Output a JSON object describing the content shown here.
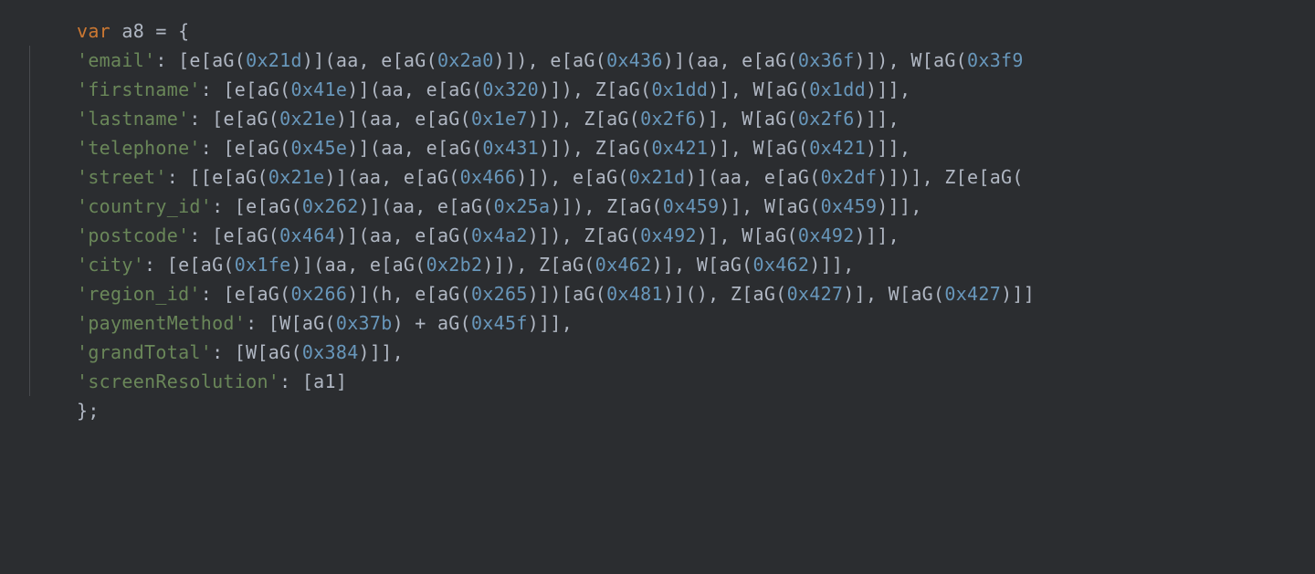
{
  "code": {
    "line1": {
      "var": "var",
      "name": "a8",
      "eq": " = {"
    },
    "entries": [
      {
        "key": "'email'",
        "sep": ": [e[aG(",
        "n1": "0x21d",
        "t1": ")](aa, e[aG(",
        "n2": "0x2a0",
        "t2": ")]), e[aG(",
        "n3": "0x436",
        "t3": ")](aa, e[aG(",
        "n4": "0x36f",
        "t4": ")]), W[aG(",
        "n5": "0x3f9",
        "tail": ""
      },
      {
        "key": "'firstname'",
        "sep": ": [e[aG(",
        "n1": "0x41e",
        "t1": ")](aa, e[aG(",
        "n2": "0x320",
        "t2": ")]), Z[aG(",
        "n3": "0x1dd",
        "t3": ")], W[aG(",
        "n4": "0x1dd",
        "t4": ")]],",
        "n5": "",
        "tail": ""
      },
      {
        "key": "'lastname'",
        "sep": ": [e[aG(",
        "n1": "0x21e",
        "t1": ")](aa, e[aG(",
        "n2": "0x1e7",
        "t2": ")]), Z[aG(",
        "n3": "0x2f6",
        "t3": ")], W[aG(",
        "n4": "0x2f6",
        "t4": ")]],",
        "n5": "",
        "tail": ""
      },
      {
        "key": "'telephone'",
        "sep": ": [e[aG(",
        "n1": "0x45e",
        "t1": ")](aa, e[aG(",
        "n2": "0x431",
        "t2": ")]), Z[aG(",
        "n3": "0x421",
        "t3": ")], W[aG(",
        "n4": "0x421",
        "t4": ")]],",
        "n5": "",
        "tail": ""
      },
      {
        "key": "'street'",
        "sep": ": [[e[aG(",
        "n1": "0x21e",
        "t1": ")](aa, e[aG(",
        "n2": "0x466",
        "t2": ")]), e[aG(",
        "n3": "0x21d",
        "t3": ")](aa, e[aG(",
        "n4": "0x2df",
        "t4": ")])], Z[e[aG(",
        "n5": "",
        "tail": ""
      },
      {
        "key": "'country_id'",
        "sep": ": [e[aG(",
        "n1": "0x262",
        "t1": ")](aa, e[aG(",
        "n2": "0x25a",
        "t2": ")]), Z[aG(",
        "n3": "0x459",
        "t3": ")], W[aG(",
        "n4": "0x459",
        "t4": ")]],",
        "n5": "",
        "tail": ""
      },
      {
        "key": "'postcode'",
        "sep": ": [e[aG(",
        "n1": "0x464",
        "t1": ")](aa, e[aG(",
        "n2": "0x4a2",
        "t2": ")]), Z[aG(",
        "n3": "0x492",
        "t3": ")], W[aG(",
        "n4": "0x492",
        "t4": ")]],",
        "n5": "",
        "tail": ""
      },
      {
        "key": "'city'",
        "sep": ": [e[aG(",
        "n1": "0x1fe",
        "t1": ")](aa, e[aG(",
        "n2": "0x2b2",
        "t2": ")]), Z[aG(",
        "n3": "0x462",
        "t3": ")], W[aG(",
        "n4": "0x462",
        "t4": ")]],",
        "n5": "",
        "tail": ""
      },
      {
        "key": "'region_id'",
        "sep": ": [e[aG(",
        "n1": "0x266",
        "t1": ")](h, e[aG(",
        "n2": "0x265",
        "t2": ")])[aG(",
        "n3": "0x481",
        "t3": ")](), Z[aG(",
        "n4": "0x427",
        "t4": ")], W[aG(",
        "n5": "0x427",
        "tail": ")]]"
      },
      {
        "key": "'paymentMethod'",
        "sep": ": [W[aG(",
        "n1": "0x37b",
        "t1": ") + aG(",
        "n2": "0x45f",
        "t2": ")]],",
        "n3": "",
        "t3": "",
        "n4": "",
        "t4": "",
        "n5": "",
        "tail": ""
      },
      {
        "key": "'grandTotal'",
        "sep": ": [W[aG(",
        "n1": "0x384",
        "t1": ")]],",
        "n2": "",
        "t2": "",
        "n3": "",
        "t3": "",
        "n4": "",
        "t4": "",
        "n5": "",
        "tail": ""
      },
      {
        "key": "'screenResolution'",
        "sep": ": [a1]",
        "n1": "",
        "t1": "",
        "n2": "",
        "t2": "",
        "n3": "",
        "t3": "",
        "n4": "",
        "t4": "",
        "n5": "",
        "tail": ""
      }
    ],
    "close": "};"
  }
}
